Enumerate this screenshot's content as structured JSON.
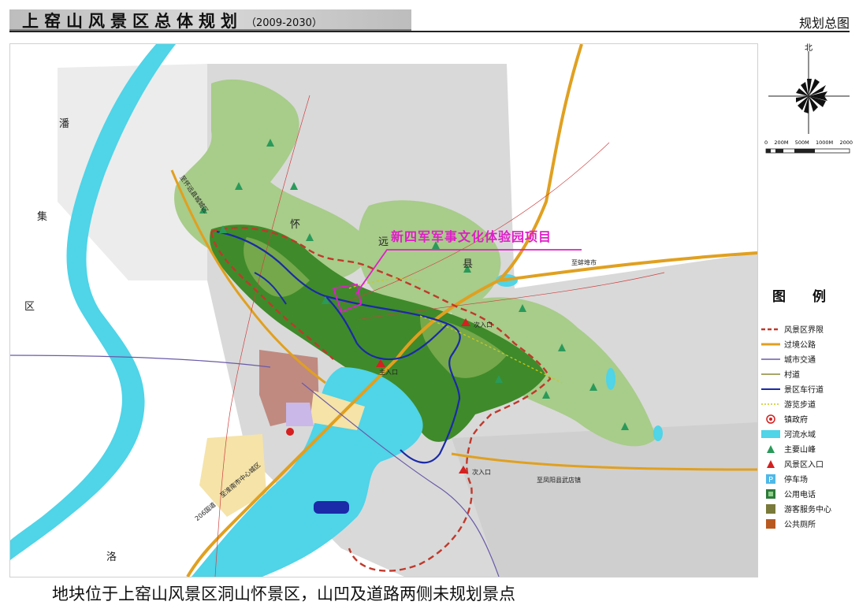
{
  "header": {
    "title": "上窑山风景区总体规划",
    "years": "（2009-2030）",
    "map_name": "规划总图"
  },
  "map": {
    "project_label": "新四军军事文化体验园项目",
    "places": {
      "pan": "潘",
      "ji": "集",
      "qu": "区",
      "luo": "洛",
      "huai": "怀",
      "yuan": "远",
      "xian": "县"
    },
    "annotations": {
      "entrance_main": "主入口",
      "entrance_sub_1": "次入口",
      "entrance_sub_2": "次入口",
      "to_bengbu": "至蚌埠市",
      "to_fengyang": "至凤阳县武店镇",
      "road_sw": "206国道",
      "road_w": "至淮南市中心城区",
      "road_nw": "至怀远县城城区"
    }
  },
  "compass": {
    "north_label": "北"
  },
  "scale_bar": {
    "labels": [
      "0",
      "200M",
      "500M",
      "1000M",
      "2000"
    ]
  },
  "legend": {
    "title": "图例",
    "items": [
      {
        "label": "风景区界限",
        "symbol": "boundary"
      },
      {
        "label": "过境公路",
        "symbol": "highway"
      },
      {
        "label": "城市交通",
        "symbol": "city-road"
      },
      {
        "label": "村道",
        "symbol": "village-road"
      },
      {
        "label": "景区车行道",
        "symbol": "scenic-road"
      },
      {
        "label": "游览步道",
        "symbol": "trail"
      },
      {
        "label": "镇政府",
        "symbol": "town-gov"
      },
      {
        "label": "河流水域",
        "symbol": "water"
      },
      {
        "label": "主要山峰",
        "symbol": "peak"
      },
      {
        "label": "风景区入口",
        "symbol": "entrance"
      },
      {
        "label": "停车场",
        "symbol": "parking"
      },
      {
        "label": "公用电话",
        "symbol": "phone"
      },
      {
        "label": "游客服务中心",
        "symbol": "visitor-center"
      },
      {
        "label": "公共厕所",
        "symbol": "toilet"
      }
    ],
    "colors": {
      "boundary": "#c0392b",
      "highway": "#e0a020",
      "city-road": "#6a5aa8",
      "village-road": "#8a8a3a",
      "scenic-road": "#1a2aa8",
      "trail": "#c8c820",
      "water": "#4fd4e8",
      "peak": "#2a9a5a",
      "entrance": "#d42020"
    }
  },
  "caption": "地块位于上窑山风景区洞山怀景区，山凹及道路两侧未规划景点"
}
